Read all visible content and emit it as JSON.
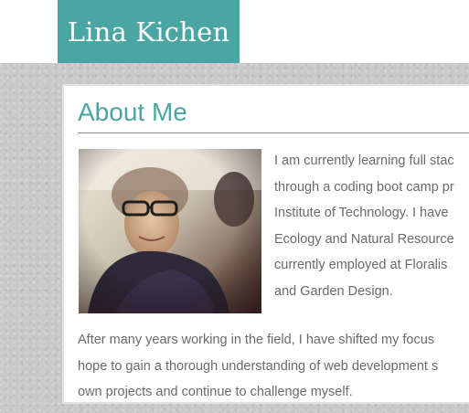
{
  "header": {
    "brand": "Lina Kichen"
  },
  "about": {
    "title": "About Me",
    "photo_alt": "profile photo",
    "para1_lines": [
      "I am currently learning full stac",
      "through a coding boot camp pr",
      "Institute of Technology. I have",
      "Ecology and Natural Resource",
      "currently employed at Floralis",
      "and Garden Design."
    ],
    "para2_lines": [
      "After many years working in the field, I have shifted my focus",
      "hope to gain a thorough understanding of web development s",
      "own projects and continue to challenge myself."
    ]
  },
  "colors": {
    "accent": "#4aa6a2",
    "body_text": "#6a6a6a",
    "backdrop": "#c9c9c9"
  }
}
